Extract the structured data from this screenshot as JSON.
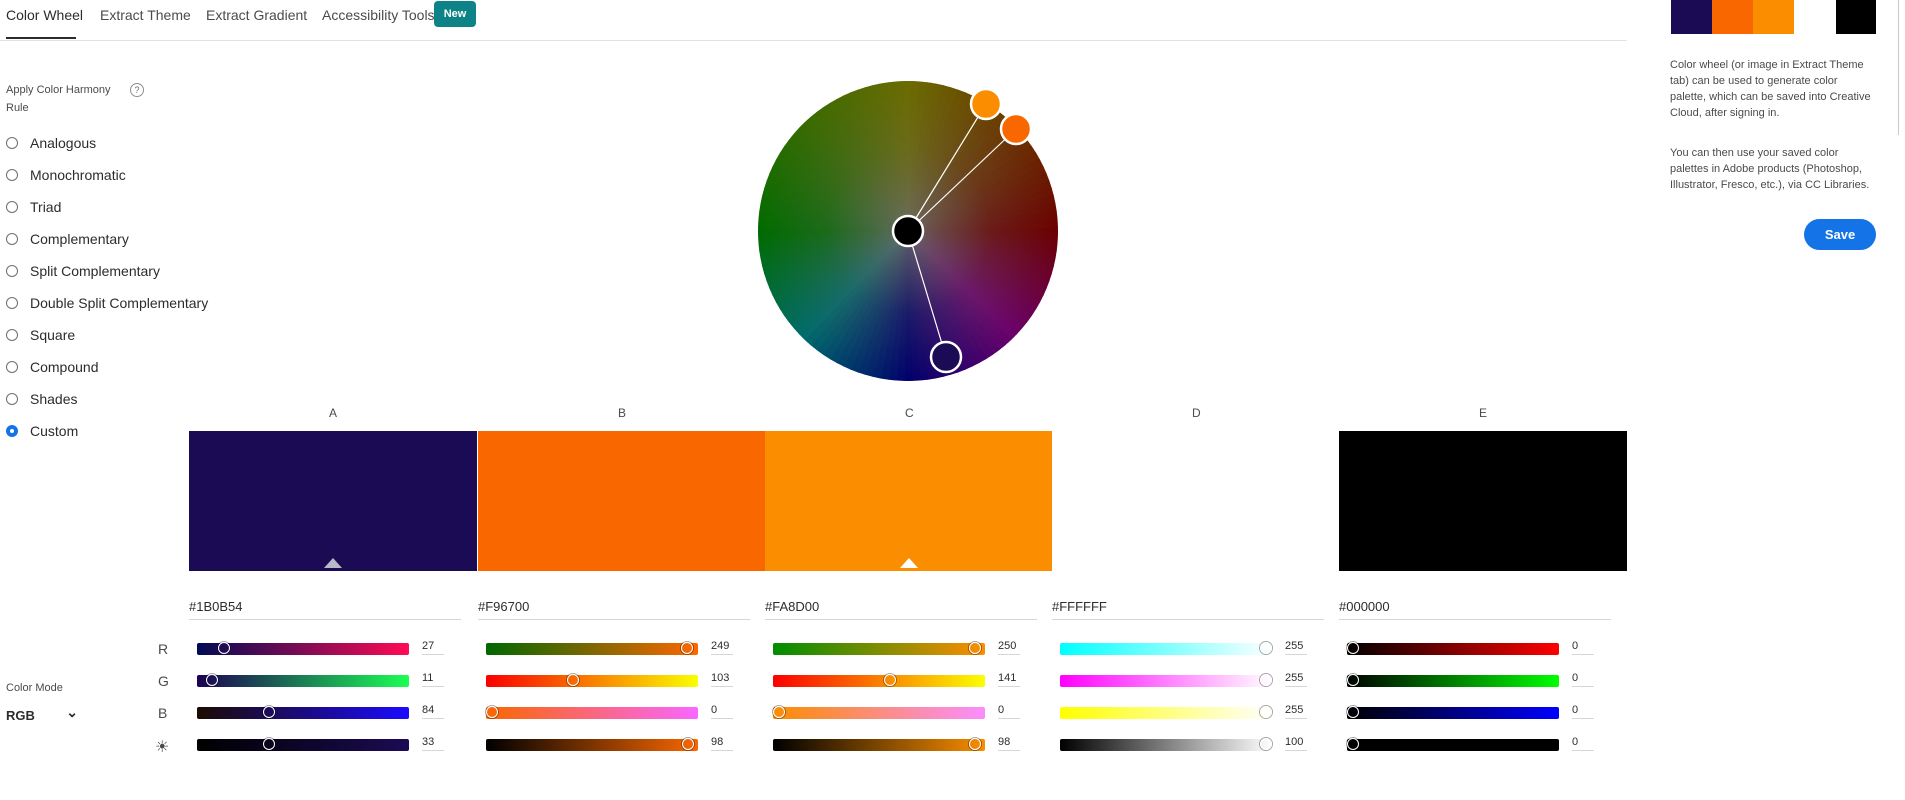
{
  "tabs": {
    "items": [
      {
        "label": "Color Wheel",
        "active": true
      },
      {
        "label": "Extract Theme",
        "active": false
      },
      {
        "label": "Extract Gradient",
        "active": false
      },
      {
        "label": "Accessibility Tools",
        "active": false
      }
    ],
    "badge": "New"
  },
  "harmony": {
    "label": "Apply Color Harmony Rule",
    "help_icon": "question-circle-icon",
    "help_glyph": "?",
    "rules": [
      "Analogous",
      "Monochromatic",
      "Triad",
      "Complementary",
      "Split Complementary",
      "Double Split Complementary",
      "Square",
      "Compound",
      "Shades",
      "Custom"
    ],
    "selected": "Custom"
  },
  "swatches": [
    {
      "label": "A",
      "hex": "#1B0B54",
      "color": "#1b0b54",
      "r": "27",
      "g": "11",
      "b": "84",
      "brightness": "33",
      "rf": 0.106,
      "gf": 0.043,
      "bf": 0.329,
      "lf": 0.33,
      "base": true
    },
    {
      "label": "B",
      "hex": "#F96700",
      "color": "#f96700",
      "r": "249",
      "g": "103",
      "b": "0",
      "brightness": "98",
      "rf": 0.976,
      "gf": 0.404,
      "bf": 0.0,
      "lf": 0.98,
      "base": false
    },
    {
      "label": "C",
      "hex": "#FA8D00",
      "color": "#fa8d00",
      "r": "250",
      "g": "141",
      "b": "0",
      "brightness": "98",
      "rf": 0.98,
      "gf": 0.553,
      "bf": 0.0,
      "lf": 0.98,
      "base": true
    },
    {
      "label": "D",
      "hex": "#FFFFFF",
      "color": "#ffffff",
      "r": "255",
      "g": "255",
      "b": "255",
      "brightness": "100",
      "rf": 1.0,
      "gf": 1.0,
      "bf": 1.0,
      "lf": 1.0,
      "base": false
    },
    {
      "label": "E",
      "hex": "#000000",
      "color": "#000000",
      "r": "0",
      "g": "0",
      "b": "0",
      "brightness": "0",
      "rf": 0.0,
      "gf": 0.0,
      "bf": 0.0,
      "lf": 0.0,
      "base": false
    }
  ],
  "channels": {
    "r": "R",
    "g": "G",
    "b": "B",
    "brightness_icon": "sun-icon",
    "brightness_glyph": "☀"
  },
  "color_mode": {
    "label": "Color Mode",
    "value": "RGB",
    "icon": "chevron-down-icon",
    "glyph": "⌄"
  },
  "panel": {
    "palette_colors": [
      "#1b0b54",
      "#f96700",
      "#fa8d00",
      "#ffffff",
      "#000000"
    ],
    "info1": "Color wheel (or image in Extract Theme tab) can be used to generate color palette, which can be saved into Creative Cloud, after signing in.",
    "info2": "You can then use your saved color palettes in Adobe products (Photoshop, Illustrator, Fresco, etc.), via CC Libraries.",
    "save_label": "Save"
  }
}
